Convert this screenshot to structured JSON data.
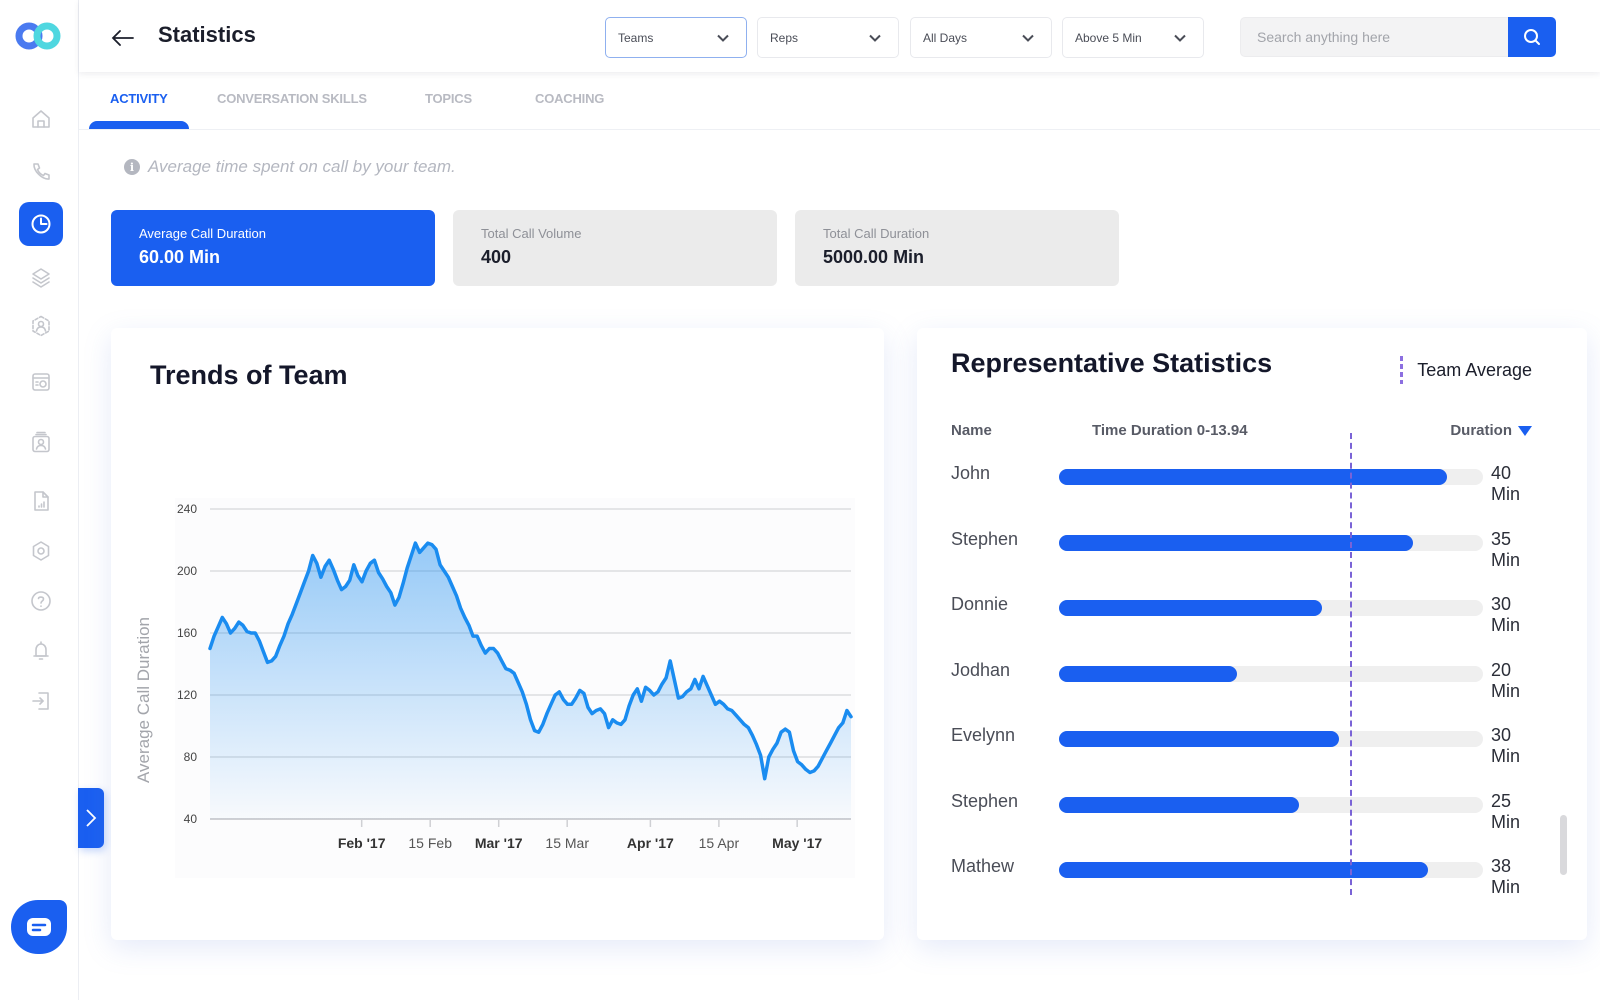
{
  "app": {
    "logo": "logo-icon",
    "page_title": "Statistics"
  },
  "sidebar": {
    "items": [
      {
        "name": "home",
        "icon": "home-icon",
        "active": false
      },
      {
        "name": "calls",
        "icon": "phone-icon",
        "active": false
      },
      {
        "name": "statistics",
        "icon": "pie-chart-icon",
        "active": true
      },
      {
        "name": "layers",
        "icon": "layers-icon",
        "active": false
      },
      {
        "name": "team",
        "icon": "team-icon",
        "active": false
      },
      {
        "name": "calendar",
        "icon": "calendar-icon",
        "active": false
      },
      {
        "name": "contacts",
        "icon": "contact-card-icon",
        "active": false
      },
      {
        "name": "reports",
        "icon": "report-icon",
        "active": false
      },
      {
        "name": "settings",
        "icon": "settings-icon",
        "active": false
      },
      {
        "name": "help",
        "icon": "help-icon",
        "active": false
      },
      {
        "name": "notifications",
        "icon": "bell-icon",
        "active": false
      },
      {
        "name": "logout",
        "icon": "logout-icon",
        "active": false
      }
    ]
  },
  "filters": [
    {
      "label": "Teams"
    },
    {
      "label": "Reps"
    },
    {
      "label": "All Days"
    },
    {
      "label": "Above 5 Min"
    }
  ],
  "search": {
    "placeholder": "Search anything here",
    "value": ""
  },
  "tabs": [
    {
      "label": "ACTIVITY",
      "active": true
    },
    {
      "label": "CONVERSATION SKILLS",
      "active": false
    },
    {
      "label": "TOPICS",
      "active": false
    },
    {
      "label": "COACHING",
      "active": false
    }
  ],
  "info_text": "Average time spent on call by your team.",
  "stats": [
    {
      "label": "Average Call Duration",
      "value": "60.00 Min",
      "active": true
    },
    {
      "label": "Total Call Volume",
      "value": "400",
      "active": false
    },
    {
      "label": "Total Call Duration",
      "value": "5000.00 Min",
      "active": false
    }
  ],
  "trend_card": {
    "title": "Trends of Team"
  },
  "rep_card": {
    "title": "Representative Statistics",
    "legend_label": "Team Average",
    "col_name": "Name",
    "col_range": "Time Duration 0-13.94",
    "col_duration": "Duration",
    "team_average_fraction": 0.686,
    "reps": [
      {
        "name": "John",
        "value": "40 Min",
        "fraction": 0.915
      },
      {
        "name": "Stephen",
        "value": "35 Min",
        "fraction": 0.835
      },
      {
        "name": "Donnie",
        "value": "30 Min",
        "fraction": 0.62
      },
      {
        "name": "Jodhan",
        "value": "20 Min",
        "fraction": 0.42
      },
      {
        "name": "Evelynn",
        "value": "30 Min",
        "fraction": 0.66
      },
      {
        "name": "Stephen",
        "value": "25 Min",
        "fraction": 0.565
      },
      {
        "name": "Mathew",
        "value": "38 Min",
        "fraction": 0.87
      }
    ]
  },
  "chart_data": {
    "type": "area",
    "title": "Trends of Team",
    "xlabel": "",
    "ylabel": "Average Call Duration",
    "ylim": [
      40,
      240
    ],
    "yticks": [
      40,
      80,
      120,
      160,
      200,
      240
    ],
    "x_start": "2017-01-01",
    "x_end": "2017-05-12",
    "xticks": [
      {
        "label": "Feb '17",
        "date": "2017-02-01",
        "bold": true
      },
      {
        "label": "15 Feb",
        "date": "2017-02-15",
        "bold": false
      },
      {
        "label": "Mar '17",
        "date": "2017-03-01",
        "bold": true
      },
      {
        "label": "15 Mar",
        "date": "2017-03-15",
        "bold": false
      },
      {
        "label": "Apr '17",
        "date": "2017-04-01",
        "bold": true
      },
      {
        "label": "15 Apr",
        "date": "2017-04-15",
        "bold": false
      },
      {
        "label": "May '17",
        "date": "2017-05-01",
        "bold": true
      }
    ],
    "grid": true,
    "series": [
      {
        "name": "Average Call Duration",
        "color": "#1a8cf0",
        "values": [
          150,
          158,
          164,
          170,
          166,
          160,
          163,
          167,
          165,
          161,
          160,
          160,
          155,
          148,
          141,
          142,
          145,
          152,
          158,
          166,
          172,
          179,
          186,
          193,
          200,
          210,
          205,
          196,
          203,
          207,
          201,
          194,
          188,
          190,
          194,
          204,
          197,
          193,
          200,
          205,
          207,
          199,
          195,
          190,
          186,
          178,
          183,
          192,
          202,
          210,
          218,
          212,
          215,
          218,
          217,
          214,
          204,
          200,
          196,
          190,
          184,
          176,
          170,
          165,
          158,
          158,
          152,
          147,
          150,
          150,
          147,
          142,
          137,
          136,
          134,
          128,
          122,
          114,
          104,
          97,
          96,
          101,
          108,
          114,
          120,
          122,
          117,
          114,
          114,
          118,
          123,
          121,
          112,
          108,
          110,
          111,
          108,
          99,
          104,
          102,
          101,
          104,
          113,
          120,
          124,
          116,
          125,
          123,
          120,
          122,
          127,
          131,
          142,
          130,
          118,
          119,
          122,
          124,
          130,
          124,
          132,
          126,
          120,
          114,
          116,
          114,
          111,
          110,
          107,
          104,
          101,
          99,
          94,
          88,
          81,
          66,
          80,
          85,
          89,
          96,
          98,
          96,
          84,
          77,
          75,
          72,
          70,
          71,
          74,
          79,
          84,
          89,
          94,
          99,
          102,
          110,
          106
        ]
      }
    ]
  }
}
